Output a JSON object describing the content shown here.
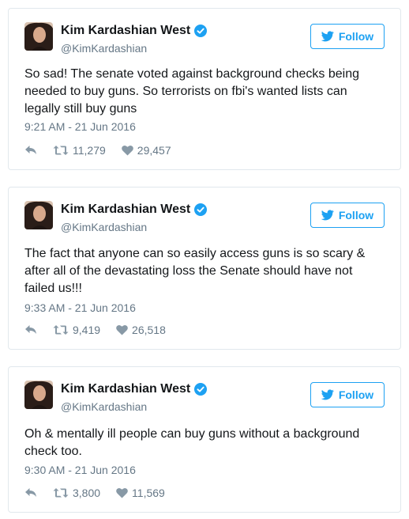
{
  "colors": {
    "accent": "#1da1f2",
    "muted": "#657786",
    "text": "#14171a",
    "border": "#e1e8ed"
  },
  "tweets": [
    {
      "name": "Kim Kardashian West",
      "handle": "@KimKardashian",
      "follow_label": "Follow",
      "text": "So sad! The senate voted against background checks being\nneeded to buy guns. So terrorists on fbi's wanted lists can\nlegally still buy guns",
      "time": "9:21 AM - 21 Jun 2016",
      "retweets": "11,279",
      "likes": "29,457",
      "icons": [
        "reply-icon",
        "retweet-icon",
        "heart-icon"
      ]
    },
    {
      "name": "Kim Kardashian West",
      "handle": "@KimKardashian",
      "follow_label": "Follow",
      "text": "The fact that anyone can so easily access guns is so scary &\nafter all of the devastating loss the Senate should have not\nfailed us!!!",
      "time": "9:33 AM - 21 Jun 2016",
      "retweets": "9,419",
      "likes": "26,518",
      "icons": [
        "reply-icon",
        "retweet-icon",
        "heart-icon"
      ]
    },
    {
      "name": "Kim Kardashian West",
      "handle": "@KimKardashian",
      "follow_label": "Follow",
      "text": "Oh & mentally ill people can buy guns without a background\ncheck too.",
      "time": "9:30 AM - 21 Jun 2016",
      "retweets": "3,800",
      "likes": "11,569",
      "icons": [
        "reply-icon",
        "retweet-icon",
        "heart-icon"
      ]
    }
  ]
}
